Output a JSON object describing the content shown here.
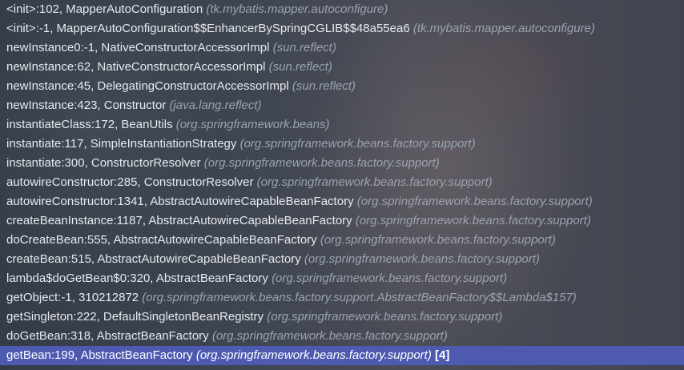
{
  "frames": [
    {
      "method": "<init>:102, MapperAutoConfiguration",
      "pkg": "(tk.mybatis.mapper.autoconfigure)"
    },
    {
      "method": "<init>:-1, MapperAutoConfiguration$$EnhancerBySpringCGLIB$$48a55ea6",
      "pkg": "(tk.mybatis.mapper.autoconfigure)"
    },
    {
      "method": "newInstance0:-1, NativeConstructorAccessorImpl",
      "pkg": "(sun.reflect)"
    },
    {
      "method": "newInstance:62, NativeConstructorAccessorImpl",
      "pkg": "(sun.reflect)"
    },
    {
      "method": "newInstance:45, DelegatingConstructorAccessorImpl",
      "pkg": "(sun.reflect)"
    },
    {
      "method": "newInstance:423, Constructor",
      "pkg": "(java.lang.reflect)"
    },
    {
      "method": "instantiateClass:172, BeanUtils",
      "pkg": "(org.springframework.beans)"
    },
    {
      "method": "instantiate:117, SimpleInstantiationStrategy",
      "pkg": "(org.springframework.beans.factory.support)"
    },
    {
      "method": "instantiate:300, ConstructorResolver",
      "pkg": "(org.springframework.beans.factory.support)"
    },
    {
      "method": "autowireConstructor:285, ConstructorResolver",
      "pkg": "(org.springframework.beans.factory.support)"
    },
    {
      "method": "autowireConstructor:1341, AbstractAutowireCapableBeanFactory",
      "pkg": "(org.springframework.beans.factory.support)"
    },
    {
      "method": "createBeanInstance:1187, AbstractAutowireCapableBeanFactory",
      "pkg": "(org.springframework.beans.factory.support)"
    },
    {
      "method": "doCreateBean:555, AbstractAutowireCapableBeanFactory",
      "pkg": "(org.springframework.beans.factory.support)"
    },
    {
      "method": "createBean:515, AbstractAutowireCapableBeanFactory",
      "pkg": "(org.springframework.beans.factory.support)"
    },
    {
      "method": "lambda$doGetBean$0:320, AbstractBeanFactory",
      "pkg": "(org.springframework.beans.factory.support)"
    },
    {
      "method": "getObject:-1, 310212872",
      "pkg": "(org.springframework.beans.factory.support.AbstractBeanFactory$$Lambda$157)"
    },
    {
      "method": "getSingleton:222, DefaultSingletonBeanRegistry",
      "pkg": "(org.springframework.beans.factory.support)"
    },
    {
      "method": "doGetBean:318, AbstractBeanFactory",
      "pkg": "(org.springframework.beans.factory.support)"
    }
  ],
  "selected": {
    "method": "getBean:199, AbstractBeanFactory",
    "pkg": "(org.springframework.beans.factory.support)",
    "count": "[4]"
  },
  "colors": {
    "selection": "#4d5ab0",
    "method_text": "#e6eaf0",
    "package_text": "#9aa3b0"
  }
}
